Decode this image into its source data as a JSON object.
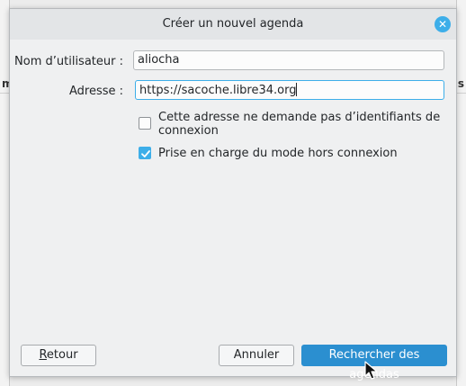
{
  "dialog": {
    "title": "Créer un nouvel agenda",
    "close_icon": "close-icon"
  },
  "form": {
    "username_label": "Nom d’utilisateur :",
    "username_value": "aliocha",
    "address_label": "Adresse :",
    "address_value": "https://sacoche.libre34.org"
  },
  "options": {
    "no_credentials_label_line1": "Cette adresse ne demande pas d’identifiants de",
    "no_credentials_label_line2": "connexion",
    "no_credentials_checked": false,
    "offline_label": "Prise en charge du mode hors connexion",
    "offline_checked": true
  },
  "buttons": {
    "back": "Retour",
    "cancel": "Annuler",
    "search": "Rechercher des agendas"
  },
  "background": {
    "left_fragment": "m",
    "right_fragment": "s"
  },
  "colors": {
    "accent": "#3daee9",
    "primary_button": "#2b8fd0"
  }
}
